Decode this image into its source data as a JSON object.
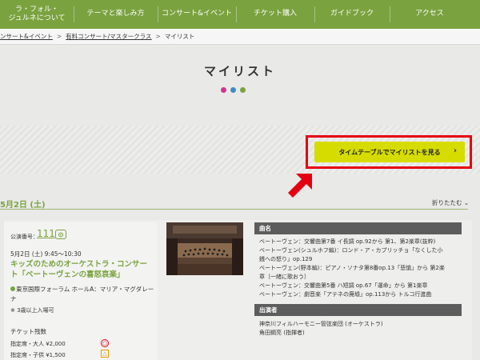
{
  "nav": {
    "items": [
      {
        "label": "ラ・フォル・\nジュルネについて"
      },
      {
        "label": "テーマと楽しみ方"
      },
      {
        "label": "コンサート&イベント"
      },
      {
        "label": "チケット購入"
      },
      {
        "label": "ガイドブック"
      },
      {
        "label": "アクセス"
      }
    ]
  },
  "breadcrumb": {
    "items": [
      "ンサート&イベント",
      "有料コンサート/マスタークラス",
      "マイリスト"
    ],
    "separator": ">"
  },
  "page": {
    "title": "マイリスト",
    "dot_colors": [
      "#d0348e",
      "#3a8fc9",
      "#7aa23f"
    ]
  },
  "timetable_button": {
    "label": "タイムテーブルでマイリストを見る",
    "chevron": "›"
  },
  "date_section": {
    "heading": "5月2日 (土)",
    "toggle_label": "折りたたむ",
    "toggle_icon": "⌄"
  },
  "concert": {
    "number_label": "公演番号：",
    "number": "111",
    "number_icon": "favorite-icon",
    "datetime": "5月2日 (土) 9:45～10:30",
    "title": "キッズのためのオーケストラ・コンサート「ベートーヴェンの喜怒哀楽」",
    "venue": "東京国際フォーラム ホールA：マリア・マグダレーナ",
    "age_note": "※ 3歳以上入場可",
    "tickets_heading": "チケット残数",
    "tickets": [
      {
        "label": "指定席・大人 ¥2,000",
        "status": "○"
      },
      {
        "label": "指定席・子供 ¥1,500",
        "status": "△"
      }
    ]
  },
  "info": {
    "program_heading": "曲名",
    "program": [
      "ベートーヴェン：交響曲第7番 イ長調 op.92から 第1、第2楽章(抜粋)",
      "ベートーヴェン(シュルホフ編)：ロンド・ア・カプリッチョ「なくした小",
      "銭への怒り」op.129",
      "ベートーヴェン(野本編)：ピアノ・ソナタ第8番op.13「悲愴」から 第2楽",
      "章〔一緒に歌おう〕",
      "ベートーヴェン：交響曲第5番 ハ短調 op.67「運命」から 第1楽章",
      "ベートーヴェン：劇音楽「アテネの廃墟」op.113から トルコ行進曲"
    ],
    "performers_heading": "出演者",
    "performers": [
      "神奈川フィルハーモニー管弦楽団 (オーケストラ)",
      "角田鋼亮 (指揮者)"
    ]
  },
  "colors": {
    "brand_green": "#7aa23f",
    "button_yellow": "#d6dc00",
    "highlight_red": "#e50012"
  }
}
